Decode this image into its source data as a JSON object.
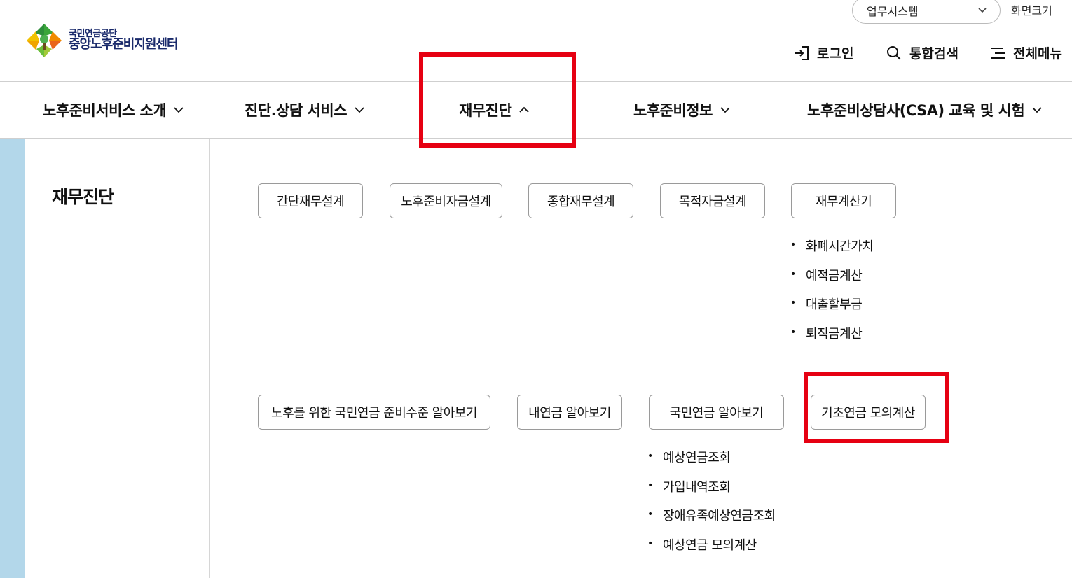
{
  "header": {
    "logo_org": "국민연금공단",
    "logo_center": "중앙노후준비지원센터",
    "system_select": "업무시스템",
    "zoom_label": "화면크기",
    "login": "로그인",
    "search": "통합검색",
    "all_menu": "전체메뉴"
  },
  "gnb": [
    {
      "label": "노후준비서비스 소개"
    },
    {
      "label": "진단.상담 서비스"
    },
    {
      "label": "재무진단"
    },
    {
      "label": "노후준비정보"
    },
    {
      "label": "노후준비상담사(CSA) 교육 및 시험"
    }
  ],
  "side": {
    "title": "재무진단"
  },
  "row1": [
    {
      "label": "간단재무설계"
    },
    {
      "label": "노후준비자금설계"
    },
    {
      "label": "종합재무설계"
    },
    {
      "label": "목적자금설계"
    },
    {
      "label": "재무계산기"
    }
  ],
  "calculator_sub": [
    "화폐시간가치",
    "예적금계산",
    "대출할부금",
    "퇴직금계산"
  ],
  "row2": [
    {
      "label": "노후를 위한 국민연금 준비수준 알아보기"
    },
    {
      "label": "내연금 알아보기"
    },
    {
      "label": "국민연금 알아보기"
    },
    {
      "label": "기초연금 모의계산"
    }
  ],
  "pension_sub": [
    "예상연금조회",
    "가입내역조회",
    "장애유족예상연금조회",
    "예상연금 모의계산"
  ],
  "colors": {
    "highlight": "#e60012",
    "side_strip": "#b3d7ea",
    "logo_text": "#1a2a6b"
  }
}
